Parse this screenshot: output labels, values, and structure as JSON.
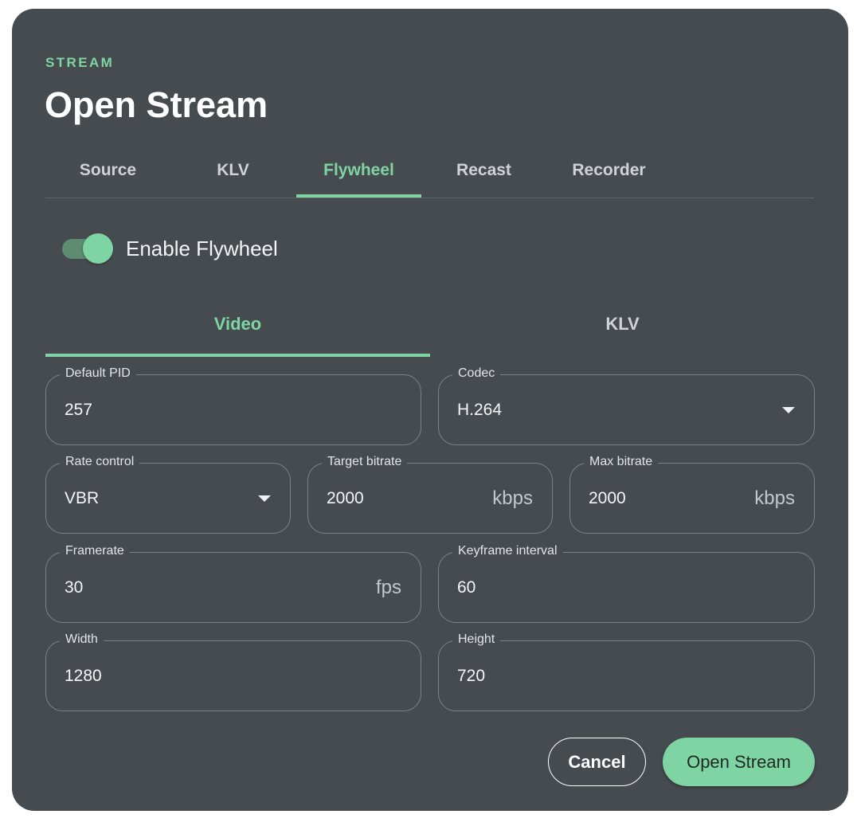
{
  "dialog": {
    "overline": "STREAM",
    "title": "Open Stream"
  },
  "tabs": [
    {
      "label": "Source",
      "active": false
    },
    {
      "label": "KLV",
      "active": false
    },
    {
      "label": "Flywheel",
      "active": true
    },
    {
      "label": "Recast",
      "active": false
    },
    {
      "label": "Recorder",
      "active": false
    }
  ],
  "flywheel": {
    "enable_label": "Enable Flywheel",
    "enabled": true
  },
  "subtabs": [
    {
      "label": "Video",
      "active": true
    },
    {
      "label": "KLV",
      "active": false
    }
  ],
  "fields": {
    "default_pid": {
      "label": "Default PID",
      "value": "257"
    },
    "codec": {
      "label": "Codec",
      "value": "H.264"
    },
    "rate_control": {
      "label": "Rate control",
      "value": "VBR"
    },
    "target_bitrate": {
      "label": "Target bitrate",
      "value": "2000",
      "suffix": "kbps"
    },
    "max_bitrate": {
      "label": "Max bitrate",
      "value": "2000",
      "suffix": "kbps"
    },
    "framerate": {
      "label": "Framerate",
      "value": "30",
      "suffix": "fps"
    },
    "keyframe_interval": {
      "label": "Keyframe interval",
      "value": "60"
    },
    "width": {
      "label": "Width",
      "value": "1280"
    },
    "height": {
      "label": "Height",
      "value": "720"
    }
  },
  "actions": {
    "cancel_label": "Cancel",
    "open_label": "Open Stream"
  },
  "colors": {
    "accent": "#7fd4a4",
    "surface": "#464b4f",
    "outline": "#7c8287"
  }
}
